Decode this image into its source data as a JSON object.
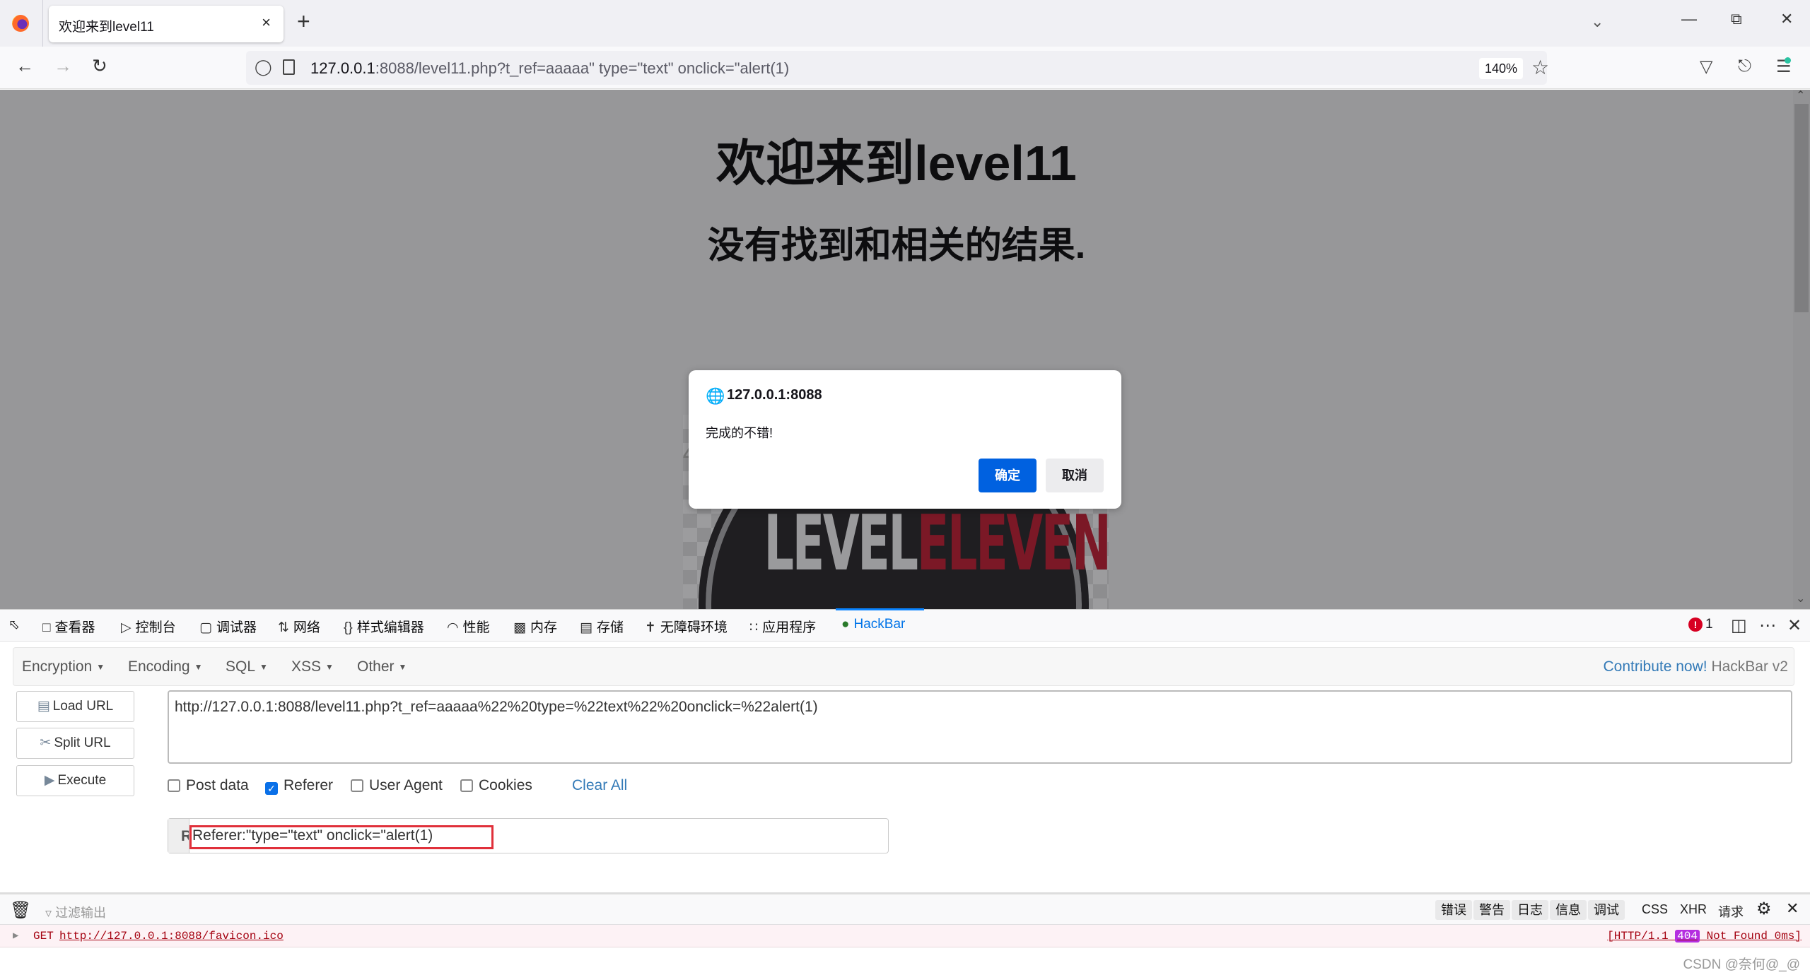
{
  "browser": {
    "tab_title": "欢迎来到level11",
    "tab_close": "×",
    "new_tab": "+",
    "url_host": "127.0.0.1",
    "url_rest": ":8088/level11.php?t_ref=aaaaa\" type=\"text\" onclick=\"alert(1)",
    "zoom_level": "140%"
  },
  "page": {
    "heading": "欢迎来到level11",
    "subheading": "没有找到和相关的结果.",
    "logo_text_left": "LEVEL",
    "logo_text_right": "ELEVEN",
    "logo_nums": [
      "4",
      "8"
    ]
  },
  "dialog": {
    "origin": "127.0.0.1:8088",
    "message": "完成的不错!",
    "ok_label": "确定",
    "cancel_label": "取消"
  },
  "devtools": {
    "tabs": [
      {
        "label": "查看器",
        "icon": "inspector-icon"
      },
      {
        "label": "控制台",
        "icon": "console-icon"
      },
      {
        "label": "调试器",
        "icon": "debugger-icon"
      },
      {
        "label": "网络",
        "icon": "network-icon"
      },
      {
        "label": "样式编辑器",
        "icon": "style-editor-icon"
      },
      {
        "label": "性能",
        "icon": "performance-icon"
      },
      {
        "label": "内存",
        "icon": "memory-icon"
      },
      {
        "label": "存储",
        "icon": "storage-icon"
      },
      {
        "label": "无障碍环境",
        "icon": "accessibility-icon"
      },
      {
        "label": "应用程序",
        "icon": "application-icon"
      },
      {
        "label": "HackBar",
        "icon": "hackbar-icon"
      }
    ],
    "error_count": "1"
  },
  "hackbar": {
    "menu": [
      "Encryption",
      "Encoding",
      "SQL",
      "XSS",
      "Other"
    ],
    "contribute": "Contribute now!",
    "brand": "HackBar v2",
    "load_url": "Load URL",
    "split_url": "Split URL",
    "execute": "Execute",
    "url_value": "http://127.0.0.1:8088/level11.php?t_ref=aaaaa%22%20type=%22text%22%20onclick=%22alert(1)",
    "options": [
      {
        "label": "Post data",
        "checked": false
      },
      {
        "label": "Referer",
        "checked": true
      },
      {
        "label": "User Agent",
        "checked": false
      },
      {
        "label": "Cookies",
        "checked": false
      }
    ],
    "clear_all": "Clear All",
    "referer_addon": "R",
    "referer_value": "Referer:\"type=\"text\" onclick=\"alert(1)"
  },
  "console": {
    "filter_placeholder": "过滤输出",
    "levels": [
      "错误",
      "警告",
      "日志",
      "信息",
      "调试"
    ],
    "toggles": [
      "CSS",
      "XHR",
      "请求"
    ],
    "entry": {
      "method": "GET",
      "url": "http://127.0.0.1:8088/favicon.ico",
      "status_prefix": "[HTTP/1.1",
      "status_code": "404",
      "status_suffix": "Not Found 0ms]"
    }
  },
  "watermark": "CSDN @奈何@_@"
}
